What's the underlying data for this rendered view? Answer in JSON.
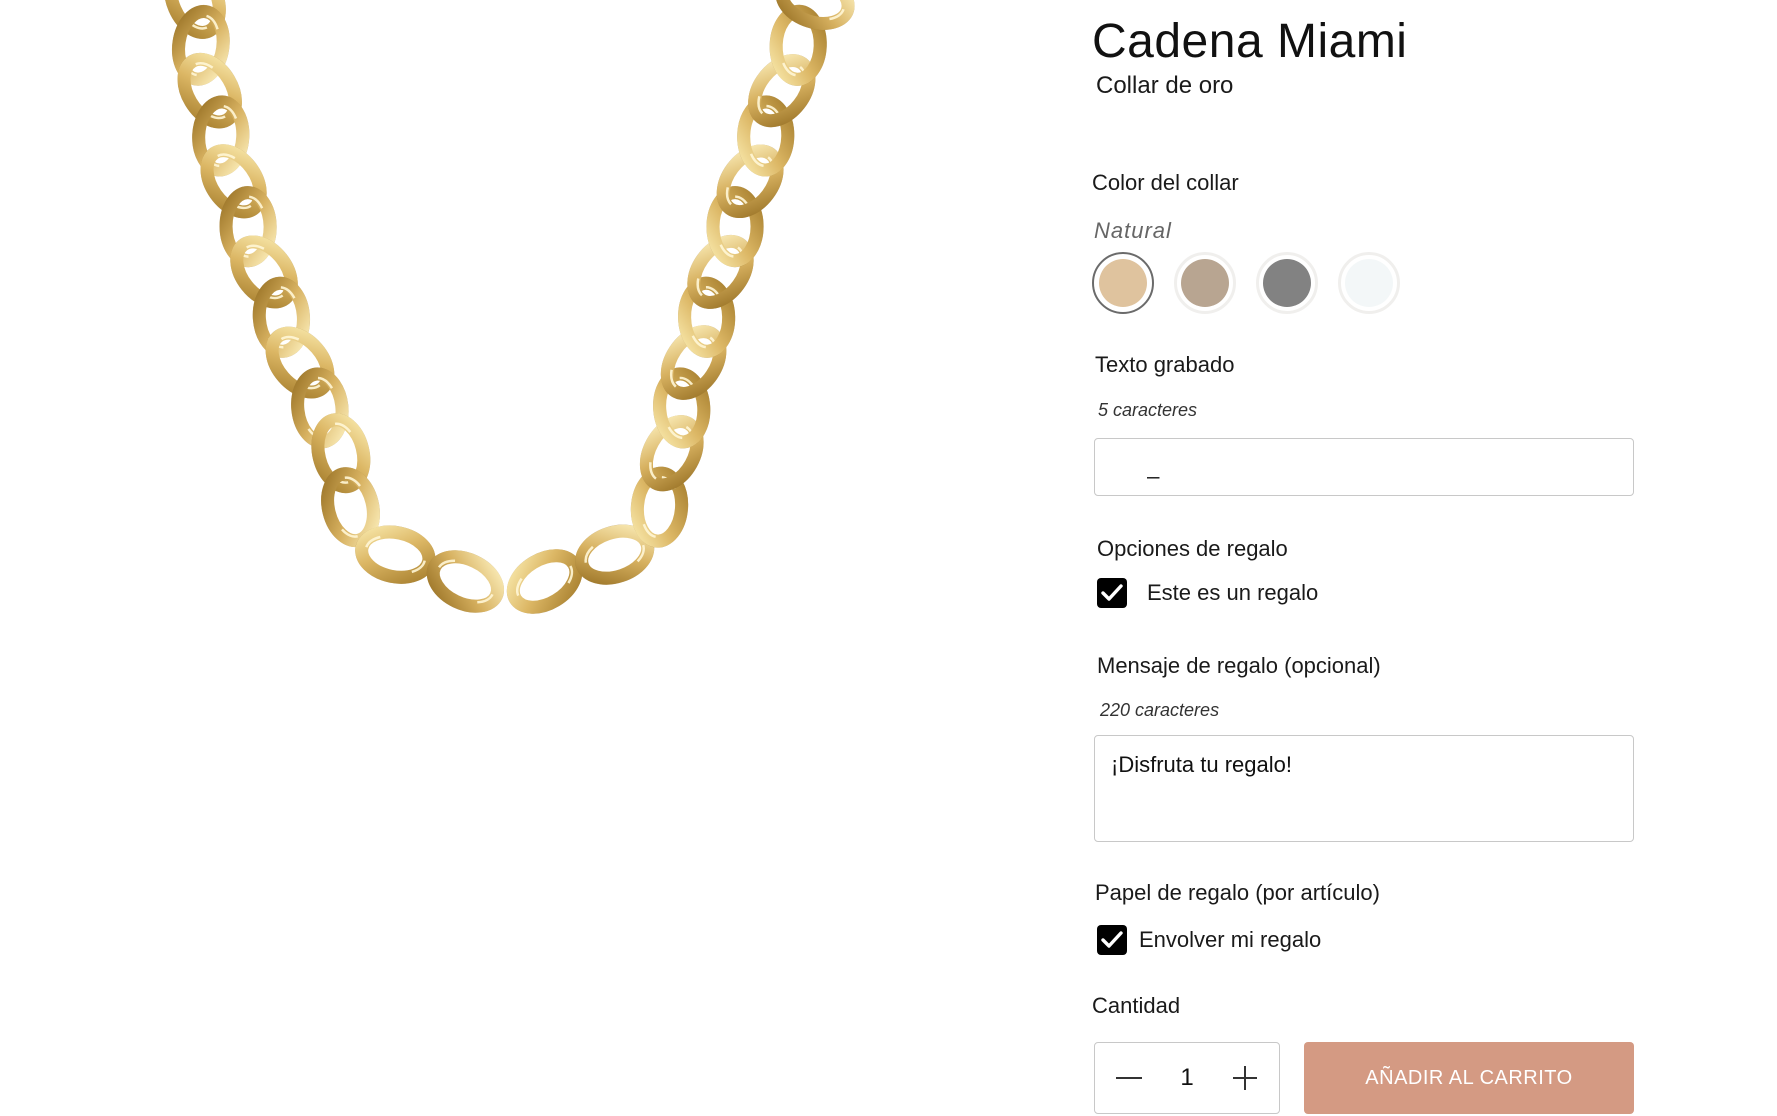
{
  "product": {
    "title": "Cadena Miami",
    "subtitle": "Collar de oro",
    "image_icon": "gold-curb-chain-necklace"
  },
  "color_option": {
    "label": "Color del collar",
    "selected_value": "Natural",
    "swatches": [
      {
        "color": "#dfc39e",
        "selected": true
      },
      {
        "color": "#b8a591",
        "selected": false
      },
      {
        "color": "#828282",
        "selected": false
      },
      {
        "color": "#f3f7f8",
        "selected": false
      }
    ]
  },
  "engraving": {
    "label": "Texto grabado",
    "hint": "5 caracteres",
    "value": "_"
  },
  "gift_options": {
    "label": "Opciones de regalo",
    "checkbox_label": "Este es un regalo",
    "checked": true
  },
  "gift_message": {
    "label": "Mensaje de regalo (opcional)",
    "hint": "220 caracteres",
    "value": "¡Disfruta tu regalo!"
  },
  "gift_wrap": {
    "label": "Papel de regalo (por artículo)",
    "checkbox_label": "Envolver mi regalo",
    "checked": true
  },
  "quantity": {
    "label": "Cantidad",
    "value": "1"
  },
  "cart": {
    "add_label": "AÑADIR AL CARRITO",
    "button_color": "#d49a83"
  }
}
